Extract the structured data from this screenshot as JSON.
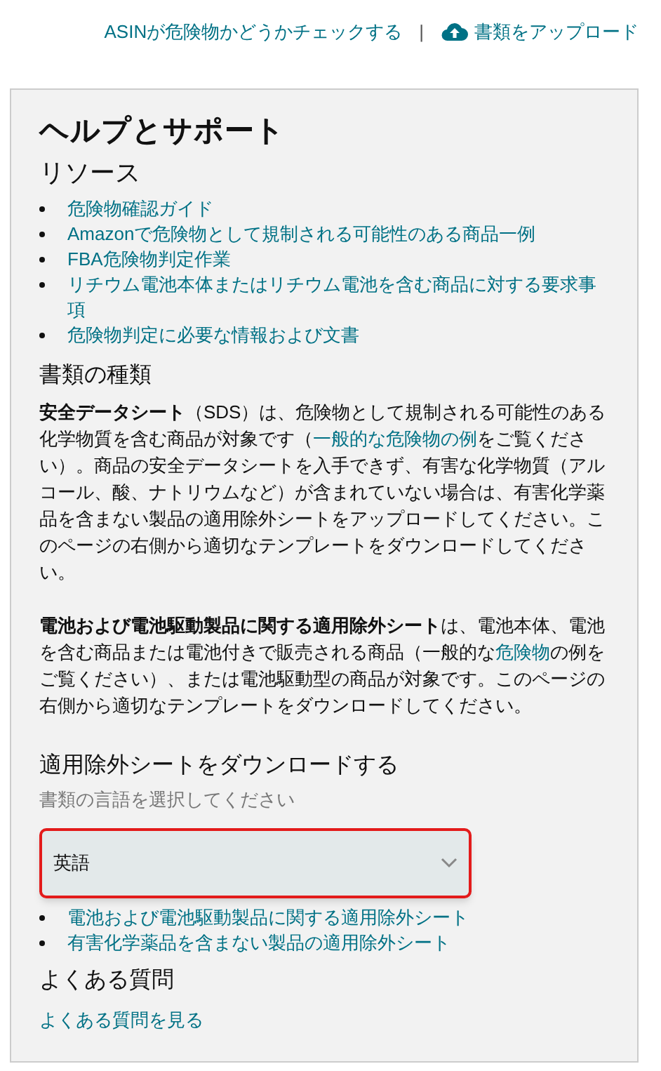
{
  "top_links": [
    {
      "kind": "link",
      "label": "ASINが危険物かどうかチェックする"
    },
    {
      "kind": "separator",
      "label": "|"
    },
    {
      "kind": "upload",
      "label": "書類をアップロード"
    }
  ],
  "panel": {
    "title": "ヘルプとサポート",
    "resources": {
      "heading": "リソース",
      "links": [
        "危険物確認ガイド",
        "Amazonで危険物として規制される可能性のある商品一例",
        "FBA危険物判定作業",
        "リチウム電池本体またはリチウム電池を含む商品に対する要求事項",
        "危険物判定に必要な情報および文書"
      ]
    },
    "document_types": {
      "heading": "書類の種類",
      "paragraphs": [
        [
          {
            "kind": "bold",
            "text": "安全データシート"
          },
          {
            "kind": "plain",
            "text": "（SDS）は、危険物として規制される可能性のある化学物質を含む商品が対象です（"
          },
          {
            "kind": "link",
            "text": "一般的な危険物の例"
          },
          {
            "kind": "plain",
            "text": "をご覧ください）。商品の安全データシートを入手できず、有害な化学物質（アルコール、酸、ナトリウムなど）が含まれていない場合は、有害化学薬品を含まない製品の適用除外シートをアップロードしてください。このページの右側から適切なテンプレートをダウンロードしてください。"
          }
        ],
        [
          {
            "kind": "bold",
            "text": "電池および電池駆動製品に関する適用除外シート"
          },
          {
            "kind": "plain",
            "text": "は、電池本体、電池を含む商品または電池付きで販売される商品（一般的な"
          },
          {
            "kind": "link",
            "text": "危険物"
          },
          {
            "kind": "plain",
            "text": "の例をご覧ください）、または電池駆動型の商品が対象です。このページの右側から適切なテンプレートをダウンロードしてください。"
          }
        ]
      ]
    },
    "download": {
      "heading": "適用除外シートをダウンロードする",
      "hint": "書類の言語を選択してください",
      "select": {
        "value": "英語",
        "focused": true
      },
      "links": [
        "電池および電池駆動製品に関する適用除外シート",
        "有害化学薬品を含まない製品の適用除外シート"
      ]
    },
    "faq": {
      "heading": "よくある質問",
      "link": "よくある質問を見る"
    }
  }
}
